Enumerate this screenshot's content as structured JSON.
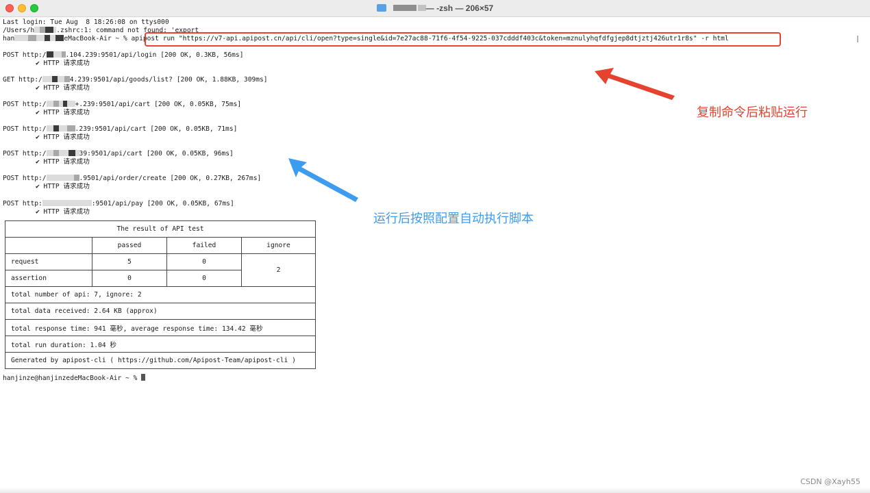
{
  "window": {
    "title": "— -zsh — 206×57"
  },
  "terminal": {
    "last_login": "Last login: Tue Aug  8 18:26:08 on ttys000",
    "zshrc_error_prefix": "/Users/h",
    "zshrc_error_suffix": ".zshrc:1: command not found: 'export",
    "prompt_prefix": "han",
    "prompt_host": "eMacBook-Air ~ % ",
    "command": "apipost run \"https://v7-api.apipost.cn/api/cli/open?type=single&id=7e27ac88-71f6-4f54-9225-037cdddf403c&token=mznulyhqfdfgjep8dtjztj426utr1r8s\" -r html",
    "requests": [
      {
        "method": "POST",
        "url_prefix": "http:/",
        "url_suffix": ".104.239:9501/api/login",
        "stats": "[200 OK, 0.3KB, 56ms]",
        "check": "✔ HTTP 请求成功"
      },
      {
        "method": "GET",
        "url_prefix": "http:/",
        "url_suffix": "4.239:9501/api/goods/list?",
        "stats": "[200 OK, 1.88KB, 309ms]",
        "check": "✔ HTTP 请求成功"
      },
      {
        "method": "POST",
        "url_prefix": "http:/",
        "url_suffix": "+.239:9501/api/cart",
        "stats": "[200 OK, 0.05KB, 75ms]",
        "check": "✔ HTTP 请求成功"
      },
      {
        "method": "POST",
        "url_prefix": "http:/",
        "url_suffix": ".239:9501/api/cart",
        "stats": "[200 OK, 0.05KB, 71ms]",
        "check": "✔ HTTP 请求成功"
      },
      {
        "method": "POST",
        "url_prefix": "http:/",
        "url_suffix": "39:9501/api/cart",
        "stats": "[200 OK, 0.05KB, 96ms]",
        "check": "✔ HTTP 请求成功"
      },
      {
        "method": "POST",
        "url_prefix": "http:/",
        "url_suffix": ".9501/api/order/create",
        "stats": "[200 OK, 0.27KB, 267ms]",
        "check": "✔ HTTP 请求成功"
      },
      {
        "method": "POST",
        "url_prefix": "http:",
        "url_suffix": ":9501/api/pay",
        "stats": "[200 OK, 0.05KB, 67ms]",
        "check": "✔ HTTP 请求成功"
      }
    ],
    "final_prompt": "hanjinze@hanjinzedeMacBook-Air ~ % "
  },
  "result_table": {
    "title": "The result of API test",
    "headers": [
      "",
      "passed",
      "failed",
      "ignore"
    ],
    "request": {
      "label": "request",
      "passed": "5",
      "failed": "0"
    },
    "assertion": {
      "label": "assertion",
      "passed": "0",
      "failed": "0"
    },
    "ignore_value": "2",
    "summary": [
      "total number of api: 7, ignore: 2",
      "total data received: 2.64 KB (approx)",
      "total response time: 941 毫秒, average response time: 134.42 毫秒",
      "total run duration: 1.04 秒",
      "Generated by apipost-cli ( https://github.com/Apipost-Team/apipost-cli )"
    ]
  },
  "annotations": {
    "copy_run": "复制命令后粘贴运行",
    "auto_exec": "运行后按照配置自动执行脚本"
  },
  "watermark": "CSDN @Xayh55",
  "colors": {
    "annotation_red": "#e5432f",
    "annotation_blue": "#3d9cf0"
  }
}
